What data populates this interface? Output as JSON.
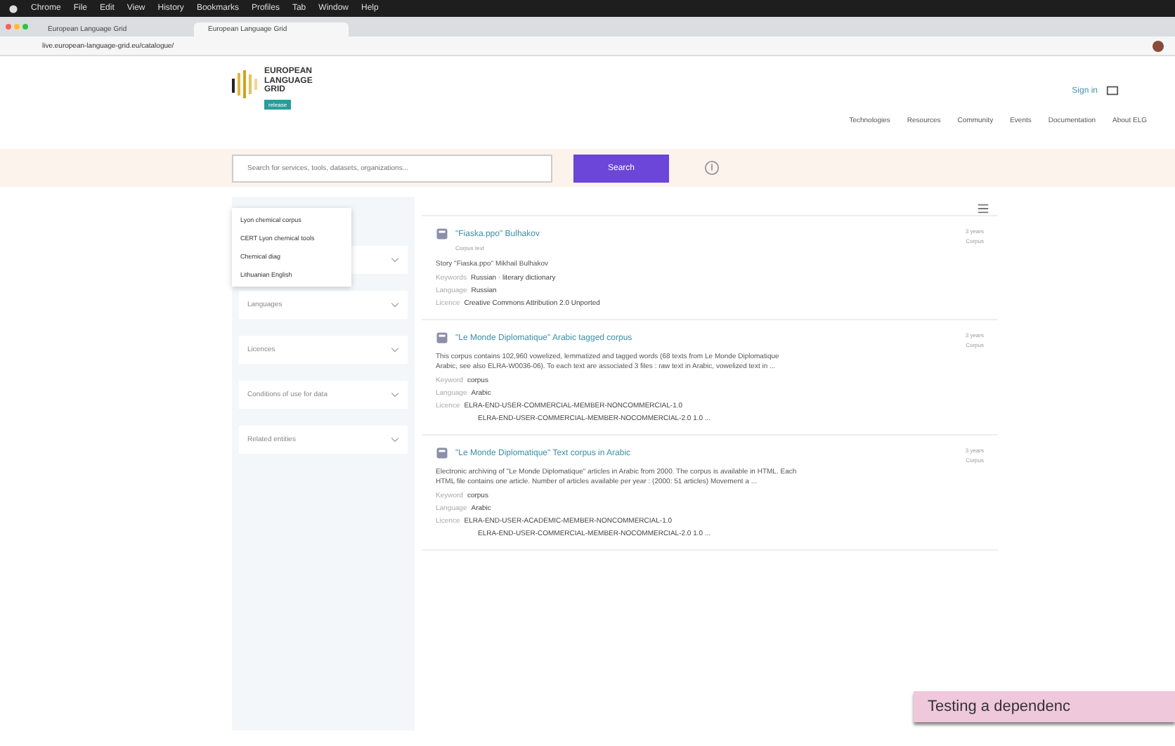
{
  "menubar": {
    "items": [
      "Chrome",
      "File",
      "Edit",
      "View",
      "History",
      "Bookmarks",
      "Profiles",
      "Tab",
      "Window",
      "Help"
    ]
  },
  "tabs": [
    {
      "label": "European Language Grid",
      "selected": false
    },
    {
      "label": "European Language Grid",
      "selected": true
    }
  ],
  "address": {
    "url": "live.european-language-grid.eu/catalogue/"
  },
  "logo": {
    "lines": [
      "EUROPEAN",
      "LANGUAGE",
      "GRID"
    ],
    "badge": "release"
  },
  "account": {
    "label": "Sign in"
  },
  "nav": [
    "Technologies",
    "Resources",
    "Community",
    "Events",
    "Documentation",
    "About ELG"
  ],
  "search": {
    "placeholder": "Search for services, tools, datasets, organizations...",
    "button": "Search"
  },
  "suggestions": [
    "Lyon chemical corpus",
    "CERT Lyon chemical tools",
    "Chemical diag",
    "Lithuanian English"
  ],
  "filters": [
    {
      "expanded": false
    },
    {
      "label": "Languages",
      "expanded": false
    },
    {
      "label": "Licences",
      "expanded": false
    },
    {
      "label": "Conditions of use for data",
      "expanded": false
    },
    {
      "label": "Related entities",
      "expanded": false
    }
  ],
  "results": [
    {
      "title": "\"Fiaska.ppo\" Bulhakov",
      "subtitle": "Corpus text",
      "description": "Story \"Fiaska.ppo\" Mikhail Bulhakov",
      "fields": [
        {
          "key": "Keywords",
          "value": "Russian · literary dictionary"
        },
        {
          "key": "Language",
          "value": "Russian"
        },
        {
          "key": "Licence",
          "value": "Creative Commons Attribution 2.0 Unported"
        }
      ],
      "date": "3 years",
      "type": "Corpus"
    },
    {
      "title": "\"Le Monde Diplomatique\" Arabic tagged corpus",
      "description": "This corpus contains 102,960 vowelized, lemmatized and tagged words (68 texts from Le Monde Diplomatique Arabic, see also ELRA-W0036-06). To each text are associated 3 files : raw text in Arabic, vowelized text in ...",
      "fields": [
        {
          "key": "Keyword",
          "value": "corpus"
        },
        {
          "key": "Language",
          "value": "Arabic"
        },
        {
          "key": "Licence",
          "value": "ELRA-END-USER-COMMERCIAL-MEMBER-NONCOMMERCIAL-1.0"
        }
      ],
      "licence_more": "ELRA-END-USER-COMMERCIAL-MEMBER-NOCOMMERCIAL-2.0 1.0 ...",
      "date": "3 years",
      "type": "Corpus"
    },
    {
      "title": "\"Le Monde Diplomatique\" Text corpus in Arabic",
      "description": "Electronic archiving of \"Le Monde Diplomatique\" articles in Arabic from 2000. The corpus is available in HTML. Each HTML file contains one article. Number of articles available per year : (2000: 51 articles) Movement a ...",
      "fields": [
        {
          "key": "Keyword",
          "value": "corpus"
        },
        {
          "key": "Language",
          "value": "Arabic"
        },
        {
          "key": "Licence",
          "value": "ELRA-END-USER-ACADEMIC-MEMBER-NONCOMMERCIAL-1.0"
        }
      ],
      "licence_more": "ELRA-END-USER-COMMERCIAL-MEMBER-NOCOMMERCIAL-2.0 1.0 ...",
      "date": "3 years",
      "type": "Corpus"
    }
  ],
  "caption": "Testing a dependenc"
}
